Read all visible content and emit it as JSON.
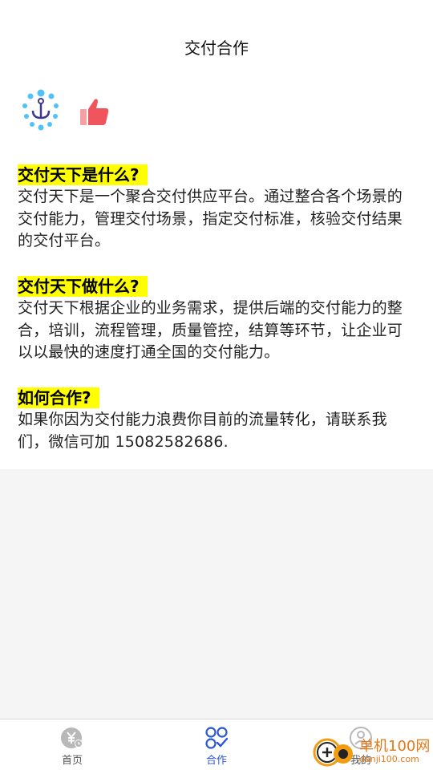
{
  "header": {
    "title": "交付合作"
  },
  "sections": [
    {
      "title": "交付天下是什么?",
      "body": "交付天下是一个聚合交付供应平台。通过整合各个场景的交付能力，管理交付场景，指定交付标准，核验交付结果的交付平台。"
    },
    {
      "title": "交付天下做什么?",
      "body": "交付天下根据企业的业务需求，提供后端的交付能力的整合，培训，流程管理，质量管控，结算等环节，让企业可以以最快的速度打通全国的交付能力。"
    },
    {
      "title": "如何合作?",
      "body": "如果你因为交付能力浪费你目前的流量转化，请联系我们，微信可加 15082582686."
    }
  ],
  "tabbar": {
    "items": [
      {
        "label": "首页",
        "icon": "yuan-clock-icon",
        "active": false
      },
      {
        "label": "合作",
        "icon": "grid-check-icon",
        "active": true
      },
      {
        "label": "我的",
        "icon": "person-icon",
        "active": false
      }
    ]
  },
  "watermark": {
    "line1": "单机100网",
    "line2": "danji100.com"
  },
  "colors": {
    "highlight": "#ffff00",
    "active_tab": "#2a56d9",
    "thumb": "#f0545c",
    "logo_dots": "#4fc3f7",
    "logo_anchor": "#3b3a8f"
  }
}
